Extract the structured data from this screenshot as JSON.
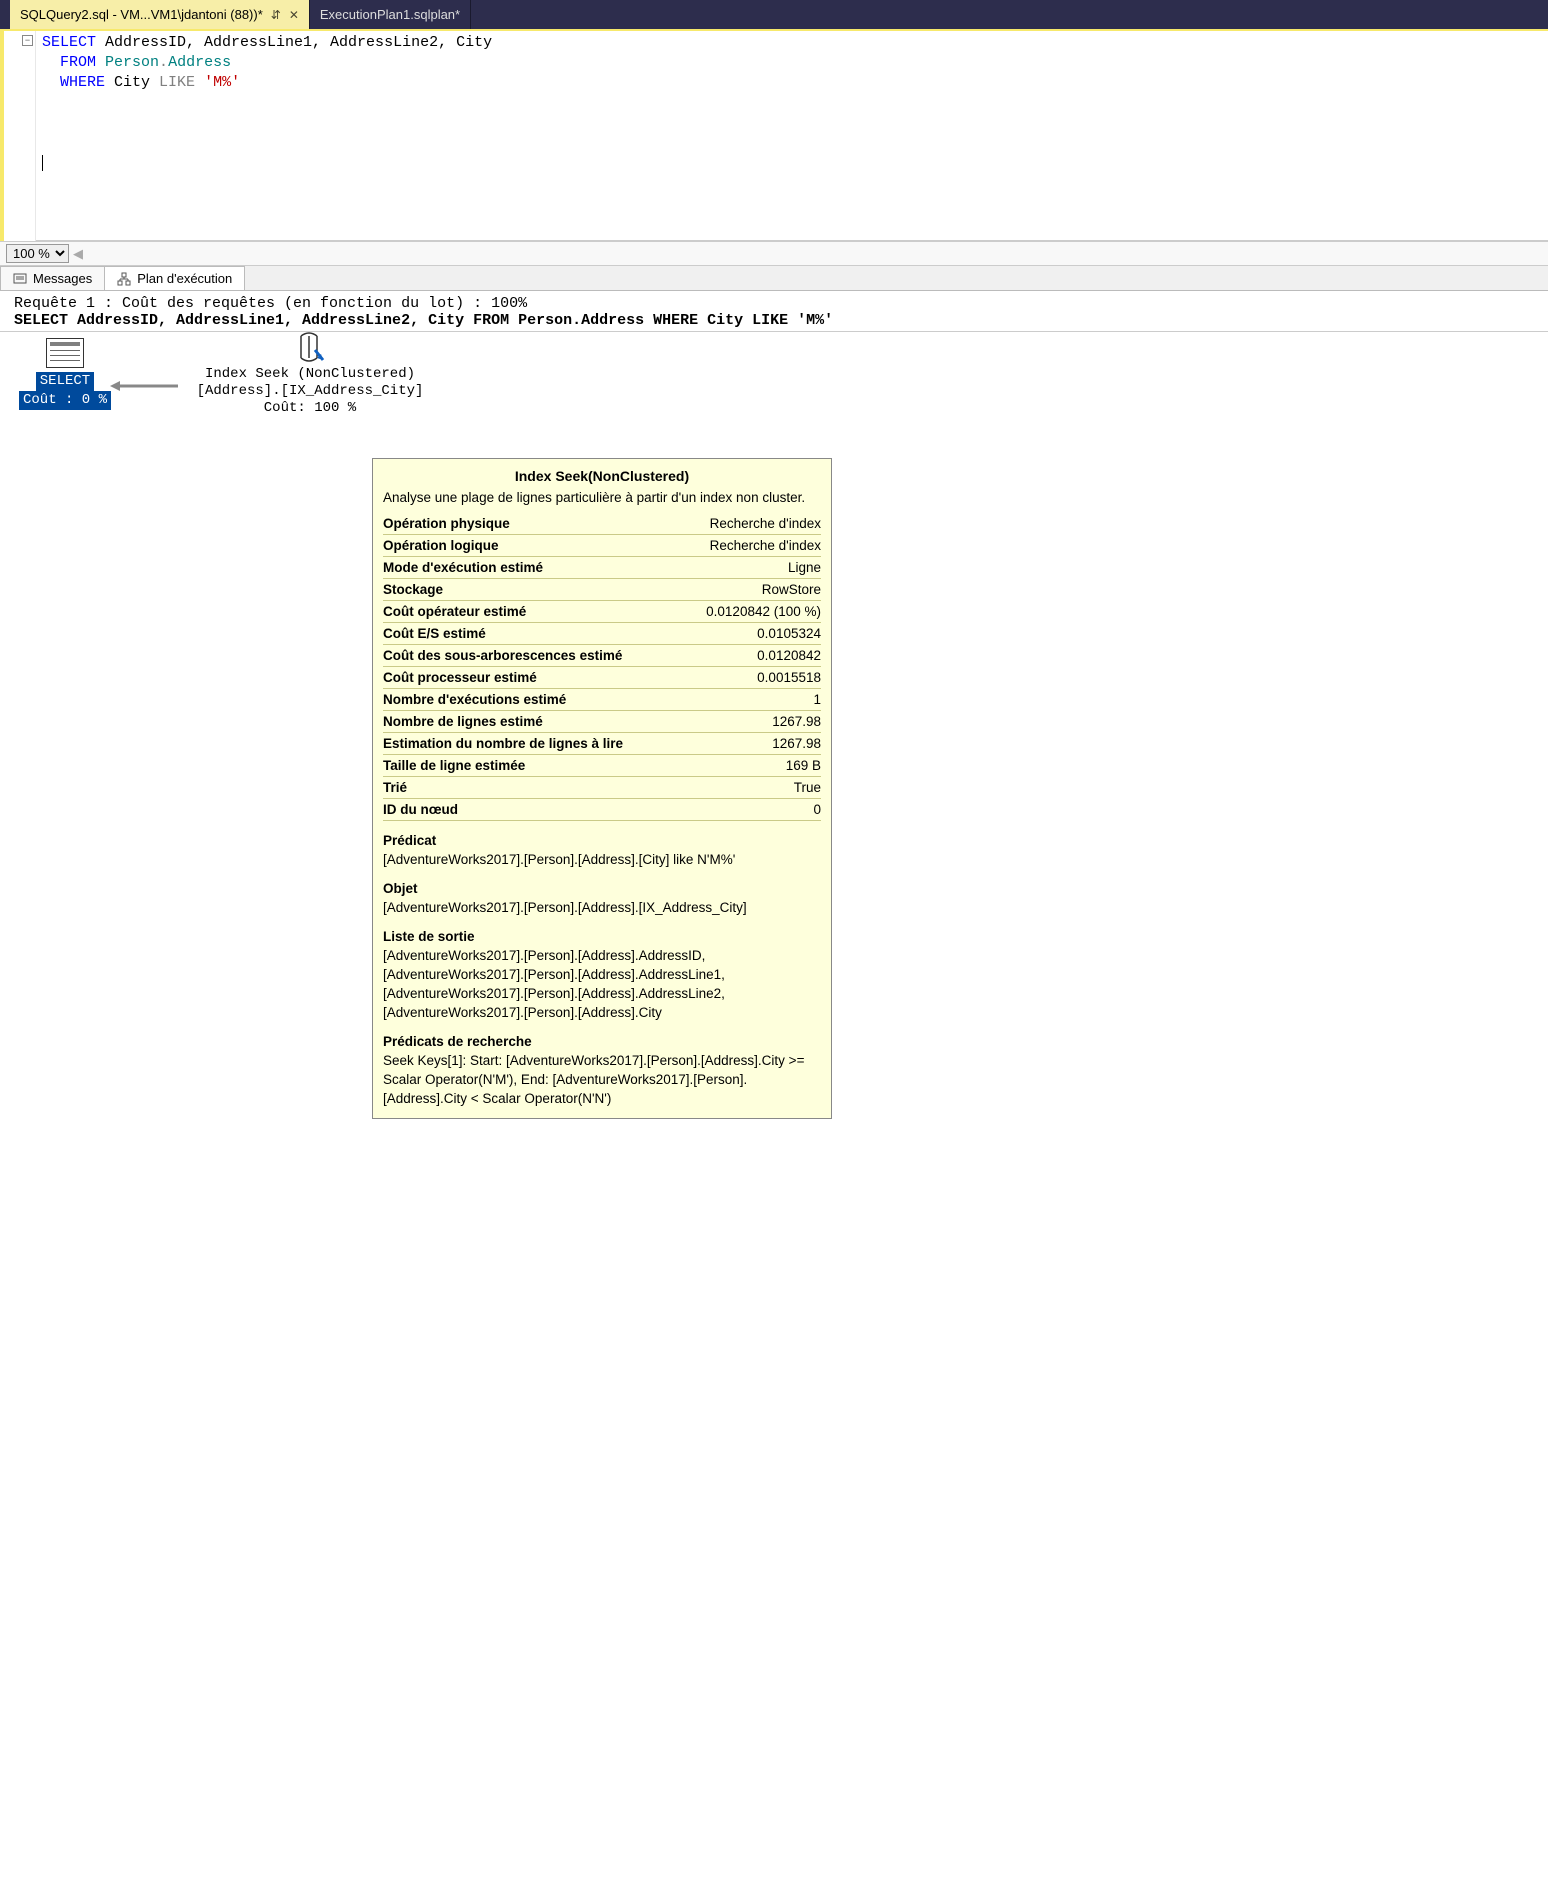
{
  "tabs": {
    "active": "SQLQuery2.sql - VM...VM1\\jdantoni (88))*",
    "inactive": "ExecutionPlan1.sqlplan*"
  },
  "sql": {
    "kw_select": "SELECT",
    "cols": " AddressID, AddressLine1, AddressLine2, City",
    "kw_from": "FROM",
    "schema": " Person",
    "dot": ".",
    "table": "Address",
    "kw_where": "WHERE",
    "col_city": " City ",
    "kw_like": "LIKE",
    "lit": " 'M%'"
  },
  "zoom": "100 %",
  "result_tabs": {
    "messages": "Messages",
    "plan": "Plan d'exécution"
  },
  "plan_header": {
    "line1": "Requête 1 : Coût des requêtes (en fonction du lot) : 100%",
    "line2": "SELECT AddressID, AddressLine1, AddressLine2, City FROM Person.Address WHERE City LIKE 'M%'"
  },
  "nodes": {
    "select": {
      "title": "SELECT",
      "cost": "Coût : 0 %"
    },
    "seek": {
      "line1": "Index Seek (NonClustered)",
      "line2": "[Address].[IX_Address_City]",
      "line3": "Coût: 100 %"
    }
  },
  "tooltip": {
    "title": "Index Seek(NonClustered)",
    "desc": "Analyse une plage de lignes particulière à partir d'un index non cluster.",
    "props": [
      {
        "k": "Opération physique",
        "v": "Recherche d'index"
      },
      {
        "k": "Opération logique",
        "v": "Recherche d'index"
      },
      {
        "k": "Mode d'exécution estimé",
        "v": "Ligne"
      },
      {
        "k": "Stockage",
        "v": "RowStore"
      },
      {
        "k": "Coût opérateur estimé",
        "v": "0.0120842 (100 %)"
      },
      {
        "k": "Coût E/S estimé",
        "v": "0.0105324"
      },
      {
        "k": "Coût des sous-arborescences estimé",
        "v": "0.0120842"
      },
      {
        "k": "Coût processeur estimé",
        "v": "0.0015518"
      },
      {
        "k": "Nombre d'exécutions estimé",
        "v": "1"
      },
      {
        "k": "Nombre de lignes estimé",
        "v": "1267.98"
      },
      {
        "k": "Estimation du nombre de lignes à lire",
        "v": "1267.98"
      },
      {
        "k": "Taille de ligne estimée",
        "v": "169 B"
      },
      {
        "k": "Trié",
        "v": "True"
      },
      {
        "k": "ID du nœud",
        "v": "0"
      }
    ],
    "sections": [
      {
        "h": "Prédicat",
        "v": "[AdventureWorks2017].[Person].[Address].[City] like N'M%'"
      },
      {
        "h": "Objet",
        "v": "[AdventureWorks2017].[Person].[Address].[IX_Address_City]"
      },
      {
        "h": "Liste de sortie",
        "v": "[AdventureWorks2017].[Person].[Address].AddressID, [AdventureWorks2017].[Person].[Address].AddressLine1, [AdventureWorks2017].[Person].[Address].AddressLine2, [AdventureWorks2017].[Person].[Address].City"
      },
      {
        "h": "Prédicats de recherche",
        "v": "Seek Keys[1]: Start: [AdventureWorks2017].[Person].[Address].City >= Scalar Operator(N'M'), End: [AdventureWorks2017].[Person].[Address].City < Scalar Operator(N'N')"
      }
    ]
  }
}
